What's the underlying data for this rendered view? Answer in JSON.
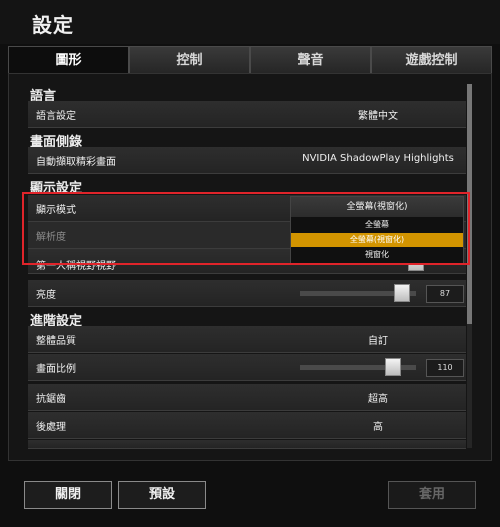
{
  "window": {
    "title": "設定"
  },
  "tabs": [
    {
      "label": "圖形",
      "active": true
    },
    {
      "label": "控制",
      "active": false
    },
    {
      "label": "聲音",
      "active": false
    },
    {
      "label": "遊戲控制",
      "active": false
    }
  ],
  "sections": {
    "language": "語言",
    "replay": "畫面側錄",
    "display": "顯示設定",
    "advanced": "進階設定"
  },
  "rows": {
    "language_setting": {
      "label": "語言設定",
      "value": "繁體中文"
    },
    "auto_capture": {
      "label": "自動擷取精彩畫面",
      "value": "NVIDIA ShadowPlay Highlights"
    },
    "display_mode": {
      "label": "顯示模式",
      "value": "全螢幕(視窗化)"
    },
    "resolution": {
      "label": "解析度"
    },
    "fpp_fov": {
      "label": "第一人稱視野視野"
    },
    "brightness": {
      "label": "亮度",
      "value": "87",
      "level_percent": 87
    },
    "overall_quality": {
      "label": "整體品質",
      "value": "自訂"
    },
    "screen_scale": {
      "label": "畫面比例",
      "value": "110",
      "level_percent": 75
    },
    "anti_aliasing": {
      "label": "抗鋸齒",
      "value": "超高"
    },
    "post_processing": {
      "label": "後處理",
      "value": "高"
    }
  },
  "display_mode_dropdown": {
    "current": "全螢幕(視窗化)",
    "options": [
      {
        "label": "全螢幕",
        "highlighted": false
      },
      {
        "label": "全螢幕(視窗化)",
        "highlighted": true
      },
      {
        "label": "視窗化",
        "highlighted": false
      }
    ]
  },
  "footer": {
    "close": "關閉",
    "defaults": "預設",
    "apply": "套用"
  },
  "colors": {
    "highlight": "#d29400",
    "annotation_box": "#e0242a"
  }
}
